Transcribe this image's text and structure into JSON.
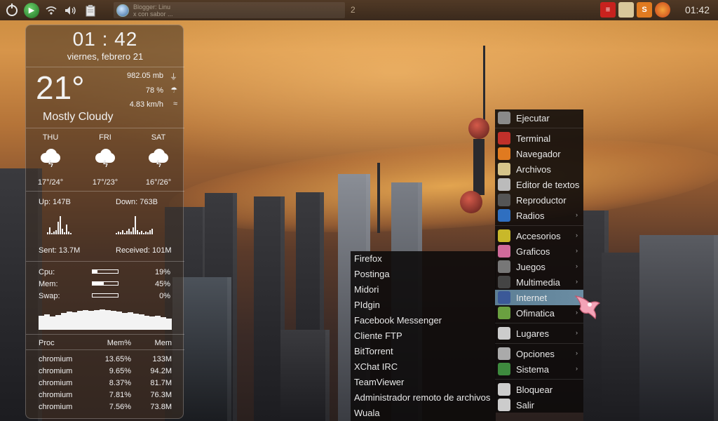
{
  "panel": {
    "power_icon": "power-icon",
    "play_icon": "play-icon",
    "wifi_icon": "wifi-icon",
    "volume_icon": "volume-icon",
    "clipboard_icon": "clipboard-icon",
    "task_title": "Blogger: Linu",
    "task_subtitle": "x con sabor ...",
    "desktop_number": "2",
    "tray_icons": [
      "terminal-app-icon",
      "folder-icon",
      "sublime-icon",
      "firefox-icon"
    ],
    "clock": "01:42"
  },
  "conky": {
    "time": "01 : 42",
    "date": "viernes, febrero 21",
    "temperature": "21°",
    "condition": "Mostly Cloudy",
    "memory": "982.05 mb",
    "humidity": "78 %",
    "wind": "4.83 km/h",
    "forecast": [
      {
        "day": "THU",
        "temp": "17°/24°"
      },
      {
        "day": "FRI",
        "temp": "17°/23°"
      },
      {
        "day": "SAT",
        "temp": "16°/26°"
      }
    ],
    "up": "Up: 147B",
    "down": "Down: 763B",
    "sent": "Sent: 13.7M",
    "received": "Received: 101M",
    "cpu_label": "Cpu:",
    "cpu_value": "19%",
    "cpu_level": 0.19,
    "mem_label": "Mem:",
    "mem_value": "45%",
    "mem_level": 0.45,
    "swap_label": "Swap:",
    "swap_value": "0%",
    "swap_level": 0.0,
    "proc_headers": [
      "Proc",
      "Mem%",
      "Mem"
    ],
    "processes": [
      {
        "name": "chromium",
        "pct": "13.65%",
        "mem": "133M"
      },
      {
        "name": "chromium",
        "pct": "9.65%",
        "mem": "94.2M"
      },
      {
        "name": "chromium",
        "pct": "8.37%",
        "mem": "81.7M"
      },
      {
        "name": "chromium",
        "pct": "7.81%",
        "mem": "76.3M"
      },
      {
        "name": "chromium",
        "pct": "7.56%",
        "mem": "73.8M"
      }
    ]
  },
  "main_menu": {
    "items": [
      {
        "label": "Ejecutar",
        "icon": "gear-icon",
        "color": "#8a8a8a",
        "submenu": false
      },
      {
        "label": "Terminal",
        "icon": "terminal-icon",
        "color": "#c0302a",
        "submenu": false
      },
      {
        "label": "Navegador",
        "icon": "firefox-icon",
        "color": "#e07a20",
        "submenu": false
      },
      {
        "label": "Archivos",
        "icon": "folder-icon",
        "color": "#d6c48a",
        "submenu": false
      },
      {
        "label": "Editor de textos",
        "icon": "text-editor-icon",
        "color": "#bbbbbb",
        "submenu": false
      },
      {
        "label": "Reproductor",
        "icon": "media-player-icon",
        "color": "#555555",
        "submenu": false
      },
      {
        "label": "Radios",
        "icon": "music-icon",
        "color": "#2f6fc0",
        "submenu": true
      },
      {
        "label": "Accesorios",
        "icon": "accessories-icon",
        "color": "#c8b82a",
        "submenu": true
      },
      {
        "label": "Graficos",
        "icon": "graphics-icon",
        "color": "#d06a9a",
        "submenu": true
      },
      {
        "label": "Juegos",
        "icon": "games-icon",
        "color": "#777777",
        "submenu": true
      },
      {
        "label": "Multimedia",
        "icon": "multimedia-icon",
        "color": "#444444",
        "submenu": true
      },
      {
        "label": "Internet",
        "icon": "facebook-icon",
        "color": "#3b5998",
        "submenu": true
      },
      {
        "label": "Ofimatica",
        "icon": "office-icon",
        "color": "#6aa040",
        "submenu": true
      },
      {
        "label": "Lugares",
        "icon": "places-icon",
        "color": "#cccccc",
        "submenu": true
      },
      {
        "label": "Opciones",
        "icon": "options-icon",
        "color": "#aaaaaa",
        "submenu": true
      },
      {
        "label": "Sistema",
        "icon": "system-icon",
        "color": "#3e8a3e",
        "submenu": true
      },
      {
        "label": "Bloquear",
        "icon": "lock-icon",
        "color": "#cccccc",
        "submenu": false
      },
      {
        "label": "Salir",
        "icon": "exit-icon",
        "color": "#cccccc",
        "submenu": false
      }
    ],
    "selected": "Internet"
  },
  "internet_submenu": {
    "items": [
      "Firefox",
      "Postinga",
      "Midori",
      "PIdgin",
      "Facebook Messenger",
      "Cliente FTP",
      "BitTorrent",
      "XChat IRC",
      "TeamViewer",
      "Administrador remoto de archivos",
      "Wuala"
    ]
  },
  "colors": {
    "accent_selected": "#6b8da3",
    "menu_bg": "#0c0a0a",
    "panel_bg": "#3c2a20"
  }
}
